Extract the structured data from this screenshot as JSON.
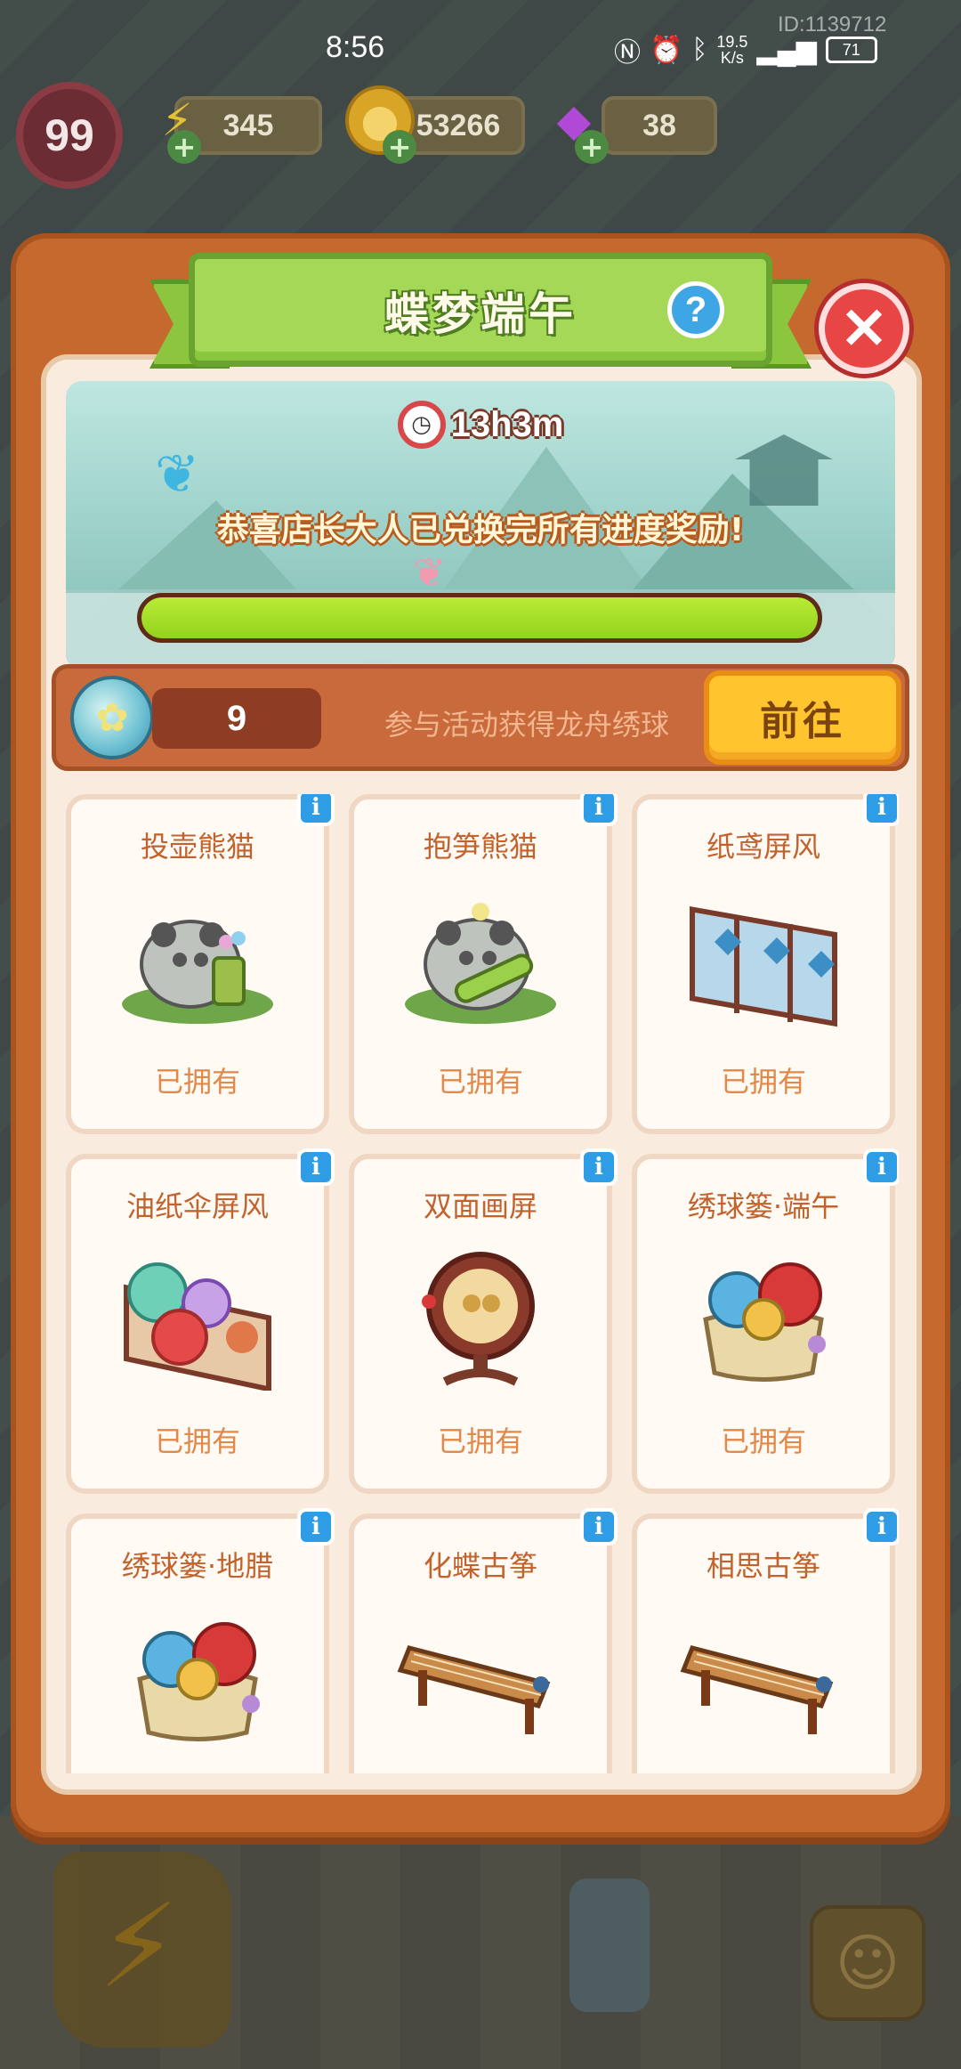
{
  "status_bar": {
    "time": "8:56",
    "net_speed_top": "19.5",
    "net_speed_unit": "K/s",
    "battery": "71",
    "player_id": "ID:1139712"
  },
  "resources": {
    "level": "99",
    "energy": "345",
    "coins": "53266",
    "gems": "38"
  },
  "panel": {
    "title": "蝶梦端午",
    "help_icon": "question-icon",
    "close_icon": "close-icon"
  },
  "banner": {
    "timer": "13h3m",
    "message": "恭喜店长大人已兑换完所有进度奖励!",
    "progress": 1.0,
    "progress_color": "#a8e02a"
  },
  "currency": {
    "count": "9",
    "hint": "参与活动获得龙舟绣球",
    "go_label": "前往"
  },
  "items": [
    {
      "name": "投壶熊猫",
      "status": "已拥有",
      "icon": "panda-vase-icon"
    },
    {
      "name": "抱笋熊猫",
      "status": "已拥有",
      "icon": "panda-bamboo-icon"
    },
    {
      "name": "纸鸢屏风",
      "status": "已拥有",
      "icon": "kite-screen-icon"
    },
    {
      "name": "油纸伞屏风",
      "status": "已拥有",
      "icon": "umbrella-screen-icon"
    },
    {
      "name": "双面画屏",
      "status": "已拥有",
      "icon": "painting-screen-icon"
    },
    {
      "name": "绣球篓·端午",
      "status": "已拥有",
      "icon": "ball-basket-icon"
    },
    {
      "name": "绣球篓·地腊",
      "status": "",
      "icon": "ball-basket-icon"
    },
    {
      "name": "化蝶古筝",
      "status": "",
      "icon": "guzheng-icon"
    },
    {
      "name": "相思古筝",
      "status": "",
      "icon": "guzheng-icon"
    }
  ],
  "colors": {
    "panel_orange": "#c5692f",
    "ribbon_green": "#a6d857",
    "close_red": "#e84545",
    "go_yellow": "#ffc42e",
    "info_blue": "#2f9de6"
  }
}
